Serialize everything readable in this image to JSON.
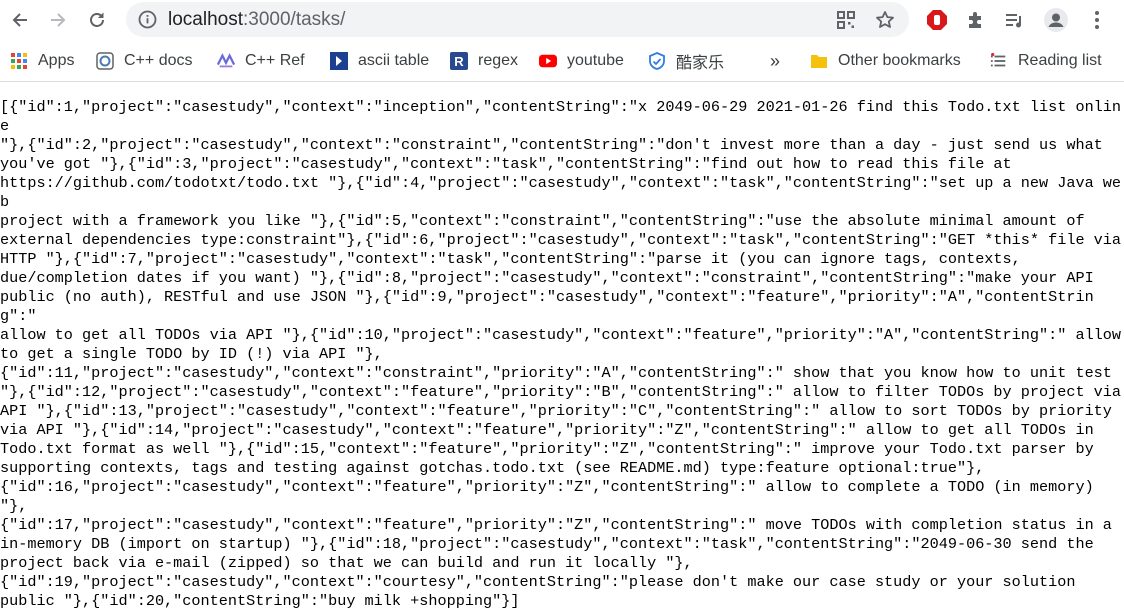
{
  "browser": {
    "url_host": "localhost",
    "url_port_path": ":3000/tasks/",
    "bookmarks": [
      {
        "label": "Apps",
        "icon": "apps-grid-icon"
      },
      {
        "label": "C++ docs",
        "icon": "cpp-docs-icon"
      },
      {
        "label": "C++ Ref",
        "icon": "cpp-ref-icon"
      },
      {
        "label": "ascii table",
        "icon": "ascii-table-icon"
      },
      {
        "label": "regex",
        "icon": "regex-icon"
      },
      {
        "label": "youtube",
        "icon": "youtube-icon"
      },
      {
        "label": "酷家乐",
        "icon": "kujiale-icon"
      }
    ],
    "overflow_label": "»",
    "other_bookmarks": "Other bookmarks",
    "reading_list": "Reading list"
  },
  "page": {
    "lines": [
      "[{\"id\":1,\"project\":\"casestudy\",\"context\":\"inception\",\"contentString\":\"x 2049-06-29 2021-01-26 find this Todo.txt list online",
      "\"},{\"id\":2,\"project\":\"casestudy\",\"context\":\"constraint\",\"contentString\":\"don't invest more than a day - just send us what",
      "you've got \"},{\"id\":3,\"project\":\"casestudy\",\"context\":\"task\",\"contentString\":\"find out how to read this file at",
      "https://github.com/todotxt/todo.txt \"},{\"id\":4,\"project\":\"casestudy\",\"context\":\"task\",\"contentString\":\"set up a new Java web",
      "project with a framework you like \"},{\"id\":5,\"context\":\"constraint\",\"contentString\":\"use the absolute minimal amount of",
      "external dependencies type:constraint\"},{\"id\":6,\"project\":\"casestudy\",\"context\":\"task\",\"contentString\":\"GET *this* file via",
      "HTTP \"},{\"id\":7,\"project\":\"casestudy\",\"context\":\"task\",\"contentString\":\"parse it (you can ignore tags, contexts,",
      "due/completion dates if you want) \"},{\"id\":8,\"project\":\"casestudy\",\"context\":\"constraint\",\"contentString\":\"make your API",
      "public (no auth), RESTful and use JSON \"},{\"id\":9,\"project\":\"casestudy\",\"context\":\"feature\",\"priority\":\"A\",\"contentString\":\"",
      "allow to get all TODOs via API \"},{\"id\":10,\"project\":\"casestudy\",\"context\":\"feature\",\"priority\":\"A\",\"contentString\":\" allow",
      "to get a single TODO by ID (!) via API \"},",
      "{\"id\":11,\"project\":\"casestudy\",\"context\":\"constraint\",\"priority\":\"A\",\"contentString\":\" show that you know how to unit test",
      "\"},{\"id\":12,\"project\":\"casestudy\",\"context\":\"feature\",\"priority\":\"B\",\"contentString\":\" allow to filter TODOs by project via",
      "API \"},{\"id\":13,\"project\":\"casestudy\",\"context\":\"feature\",\"priority\":\"C\",\"contentString\":\" allow to sort TODOs by priority",
      "via API \"},{\"id\":14,\"project\":\"casestudy\",\"context\":\"feature\",\"priority\":\"Z\",\"contentString\":\" allow to get all TODOs in",
      "Todo.txt format as well \"},{\"id\":15,\"context\":\"feature\",\"priority\":\"Z\",\"contentString\":\" improve your Todo.txt parser by",
      "supporting contexts, tags and testing against gotchas.todo.txt (see README.md) type:feature optional:true\"},",
      "{\"id\":16,\"project\":\"casestudy\",\"context\":\"feature\",\"priority\":\"Z\",\"contentString\":\" allow to complete a TODO (in memory) \"},",
      "{\"id\":17,\"project\":\"casestudy\",\"context\":\"feature\",\"priority\":\"Z\",\"contentString\":\" move TODOs with completion status in a",
      "in-memory DB (import on startup) \"},{\"id\":18,\"project\":\"casestudy\",\"context\":\"task\",\"contentString\":\"2049-06-30 send the",
      "project back via e-mail (zipped) so that we can build and run it locally \"},",
      "{\"id\":19,\"project\":\"casestudy\",\"context\":\"courtesy\",\"contentString\":\"please don't make our case study or your solution",
      "public \"},{\"id\":20,\"contentString\":\"buy milk +shopping\"}]"
    ]
  }
}
